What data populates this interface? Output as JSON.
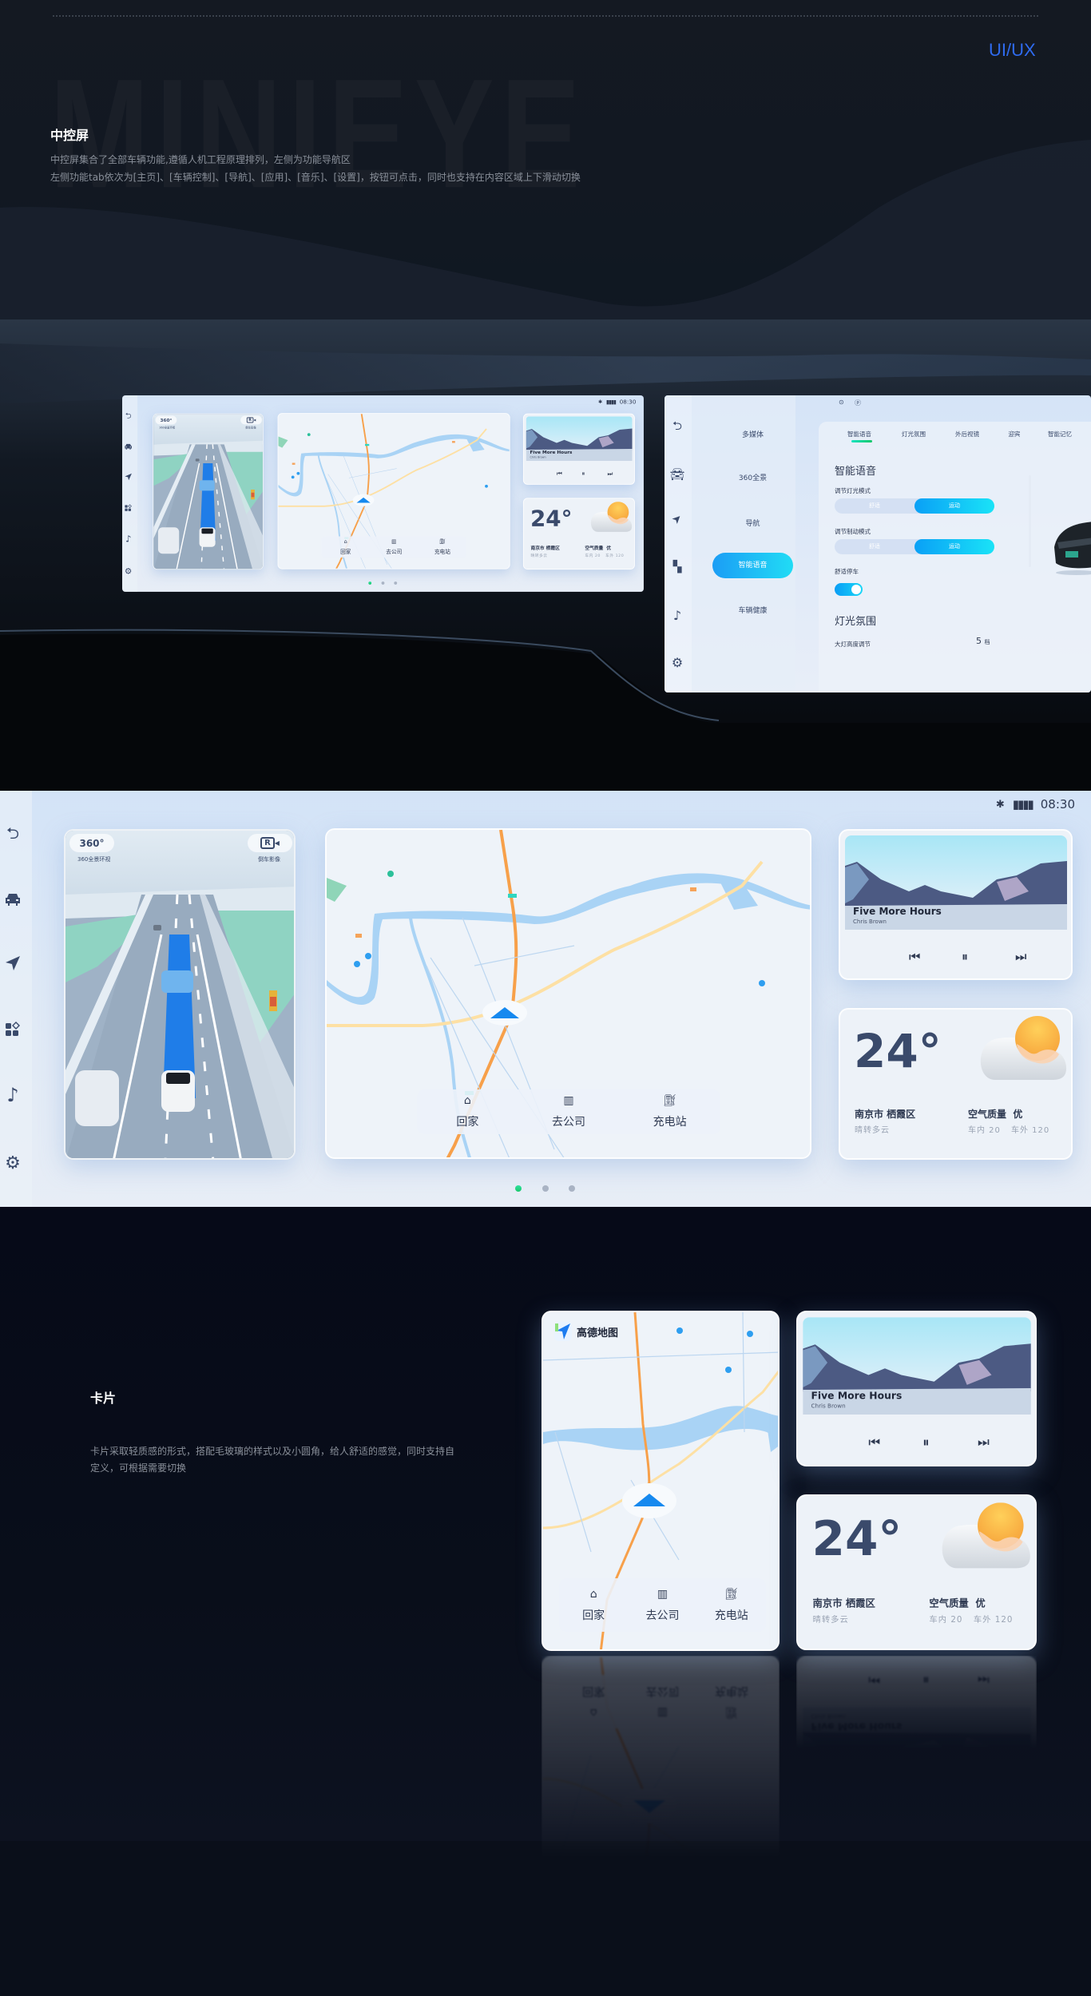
{
  "header": {
    "watermark": "MINIEYE",
    "tag": "UI/UX",
    "title": "中控屏",
    "desc": [
      "中控屏集合了全部车辆功能,遵循人机工程原理排列，左侧为功能导航区",
      "左侧功能tab依次为[主页]、[车辆控制]、[导航]、[应用]、[音乐]、[设置]，按钮可点击，同时也支持在内容区域上下滑动切换"
    ]
  },
  "sidebar_icons": [
    "home-icon",
    "car-icon",
    "navigation-icon",
    "apps-icon",
    "music-icon",
    "settings-icon"
  ],
  "status": {
    "time": "08:30",
    "bluetooth": "bluetooth-icon",
    "signal": "signal-icon"
  },
  "view360": {
    "btn_360": "360°",
    "label_360": "360全景环视",
    "btn_rear": "R",
    "label_rear": "倒车影像"
  },
  "map": {
    "brand": "高德地图",
    "quick": [
      {
        "label": "回家",
        "icon": "home-icon"
      },
      {
        "label": "去公司",
        "icon": "office-icon"
      },
      {
        "label": "充电站",
        "icon": "charging-station-icon"
      }
    ]
  },
  "pager": {
    "count": 3,
    "active": 0
  },
  "music": {
    "title": "Five More Hours",
    "artist": "Chris Brown"
  },
  "weather": {
    "temp": "24°",
    "location": "南京市 栖霞区",
    "condition": "晴转多云",
    "aqi_label": "空气质量",
    "aqi_value": "优",
    "inside": "车内 20",
    "outside": "车外 120"
  },
  "settings_screen": {
    "menu": [
      "多媒体",
      "360全景",
      "导航",
      "智能语音",
      "车辆健康"
    ],
    "active_menu": 3,
    "tabs": [
      "智能语音",
      "灯光氛围",
      "外后视镜",
      "迎宾",
      "智能记忆"
    ],
    "active_tab": 0,
    "section1": "智能语音",
    "light_mode_label": "调节灯光模式",
    "brake_mode_label": "调节制动模式",
    "options": [
      "舒适",
      "运动"
    ],
    "selected": "运动",
    "parking_label": "舒适停车",
    "parking_on": true,
    "section2": "灯光氛围",
    "headlight_label": "大灯高度调节",
    "headlight_value": "5",
    "headlight_unit": "档"
  },
  "cards_section": {
    "title": "卡片",
    "desc": [
      "卡片采取轻质感的形式，搭配毛玻璃的样式以及小圆角，给人舒适的感觉，同时支持自",
      "定义，可根据需要切换"
    ]
  },
  "colors": {
    "accent": "#1b9df5",
    "tag": "#2f6bf0",
    "pager_active": "#1ac86a",
    "route": "#f7a04a"
  }
}
